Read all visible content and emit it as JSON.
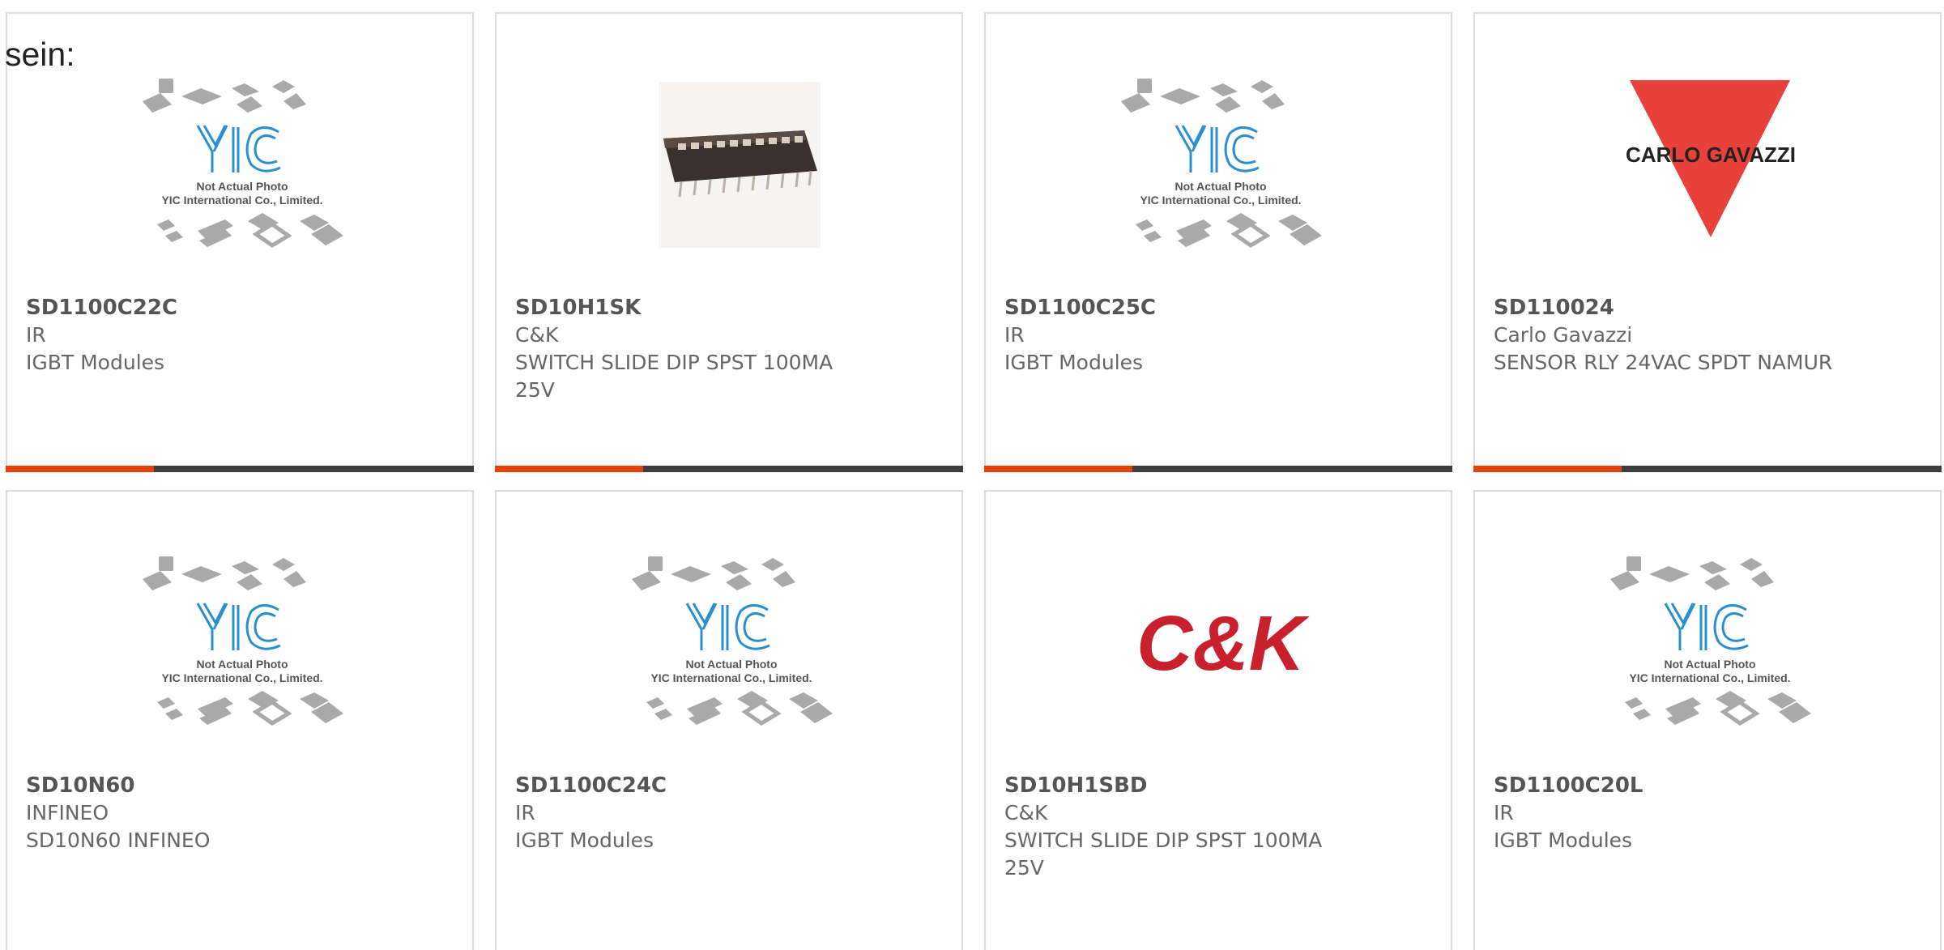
{
  "intro_text": "sein:",
  "placeholder_image": {
    "logo_text": "YIC",
    "line1": "Not Actual Photo",
    "line2": "YIC International Co., Limited."
  },
  "colors": {
    "accent": "#e8400c",
    "bar": "#3d3d3d",
    "border": "#dcdcdc",
    "yic_blue": "#2a8fd0",
    "carlo_red": "#e8413a",
    "ck_red": "#c8202c"
  },
  "products": [
    {
      "part_number": "SD1100C22C",
      "manufacturer": "IR",
      "description": "IGBT Modules",
      "image": "yic-placeholder"
    },
    {
      "part_number": "SD10H1SK",
      "manufacturer": "C&K",
      "description": "SWITCH SLIDE DIP SPST 100MA 25V",
      "image": "dip-switch-photo"
    },
    {
      "part_number": "SD1100C25C",
      "manufacturer": "IR",
      "description": "IGBT Modules",
      "image": "yic-placeholder"
    },
    {
      "part_number": "SD110024",
      "manufacturer": "Carlo Gavazzi",
      "description": "SENSOR RLY 24VAC SPDT NAMUR",
      "image": "carlo-gavazzi-logo",
      "logo_text": "CARLO GAVAZZI"
    },
    {
      "part_number": "SD10N60",
      "manufacturer": "INFINEO",
      "description": "SD10N60 INFINEO",
      "image": "yic-placeholder"
    },
    {
      "part_number": "SD1100C24C",
      "manufacturer": "IR",
      "description": "IGBT Modules",
      "image": "yic-placeholder"
    },
    {
      "part_number": "SD10H1SBD",
      "manufacturer": "C&K",
      "description": "SWITCH SLIDE DIP SPST 100MA 25V",
      "image": "ck-logo",
      "logo_text": "C&K"
    },
    {
      "part_number": "SD1100C20L",
      "manufacturer": "IR",
      "description": "IGBT Modules",
      "image": "yic-placeholder"
    }
  ]
}
